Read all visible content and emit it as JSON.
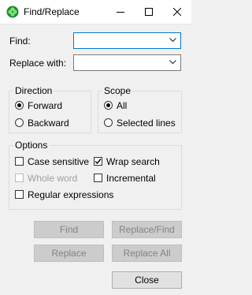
{
  "window": {
    "title": "Find/Replace",
    "app_icon": "green-clover-icon",
    "controls": [
      "minimize-icon",
      "maximize-icon",
      "close-icon"
    ]
  },
  "fields": {
    "find_label": "Find:",
    "find_value": "",
    "replace_label": "Replace with:",
    "replace_value": ""
  },
  "direction": {
    "title": "Direction",
    "options": [
      {
        "label": "Forward",
        "checked": true
      },
      {
        "label": "Backward",
        "checked": false
      }
    ]
  },
  "scope": {
    "title": "Scope",
    "options": [
      {
        "label": "All",
        "checked": true
      },
      {
        "label": "Selected lines",
        "checked": false
      }
    ]
  },
  "options": {
    "title": "Options",
    "case_sensitive": {
      "label": "Case sensitive",
      "checked": false,
      "enabled": true
    },
    "wrap_search": {
      "label": "Wrap search",
      "checked": true,
      "enabled": true
    },
    "whole_word": {
      "label": "Whole word",
      "checked": false,
      "enabled": false
    },
    "incremental": {
      "label": "Incremental",
      "checked": false,
      "enabled": true
    },
    "regular_expressions": {
      "label": "Regular expressions",
      "checked": false,
      "enabled": true
    }
  },
  "buttons": {
    "find": "Find",
    "replace_find": "Replace/Find",
    "replace": "Replace",
    "replace_all": "Replace All",
    "close": "Close"
  },
  "colors": {
    "focus_border": "#0078d7",
    "background": "#f0f0f0",
    "disabled_text": "#a0a0a0"
  }
}
